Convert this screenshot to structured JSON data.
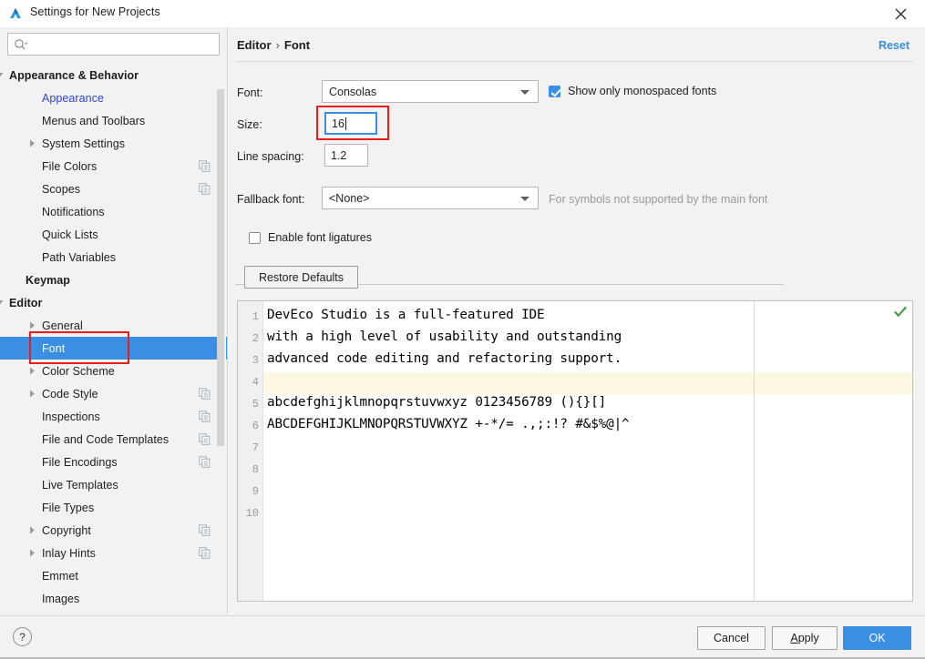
{
  "window": {
    "title": "Settings for New Projects",
    "icon": "deveco-studio-logo",
    "close_label": "×"
  },
  "search": {
    "value": "",
    "placeholder": "",
    "icon": "search-icon"
  },
  "sidebar": {
    "items": [
      {
        "label": "Appearance & Behavior",
        "indent": 10,
        "arrow": "down",
        "bold": true,
        "link": false,
        "selected": false,
        "copy": false
      },
      {
        "label": "Appearance",
        "indent": 46,
        "arrow": "none",
        "bold": false,
        "link": true,
        "selected": false,
        "copy": false
      },
      {
        "label": "Menus and Toolbars",
        "indent": 46,
        "arrow": "none",
        "bold": false,
        "link": false,
        "selected": false,
        "copy": false
      },
      {
        "label": "System Settings",
        "indent": 46,
        "arrow": "right",
        "bold": false,
        "link": false,
        "selected": false,
        "copy": false
      },
      {
        "label": "File Colors",
        "indent": 46,
        "arrow": "none",
        "bold": false,
        "link": false,
        "selected": false,
        "copy": true
      },
      {
        "label": "Scopes",
        "indent": 46,
        "arrow": "none",
        "bold": false,
        "link": false,
        "selected": false,
        "copy": true
      },
      {
        "label": "Notifications",
        "indent": 46,
        "arrow": "none",
        "bold": false,
        "link": false,
        "selected": false,
        "copy": false
      },
      {
        "label": "Quick Lists",
        "indent": 46,
        "arrow": "none",
        "bold": false,
        "link": false,
        "selected": false,
        "copy": false
      },
      {
        "label": "Path Variables",
        "indent": 46,
        "arrow": "none",
        "bold": false,
        "link": false,
        "selected": false,
        "copy": false
      },
      {
        "label": "Keymap",
        "indent": 28,
        "arrow": "none",
        "bold": true,
        "link": false,
        "selected": false,
        "copy": false
      },
      {
        "label": "Editor",
        "indent": 10,
        "arrow": "down",
        "bold": true,
        "link": false,
        "selected": false,
        "copy": false
      },
      {
        "label": "General",
        "indent": 46,
        "arrow": "right",
        "bold": false,
        "link": false,
        "selected": false,
        "copy": false
      },
      {
        "label": "Font",
        "indent": 46,
        "arrow": "none",
        "bold": false,
        "link": false,
        "selected": true,
        "copy": false
      },
      {
        "label": "Color Scheme",
        "indent": 46,
        "arrow": "right",
        "bold": false,
        "link": false,
        "selected": false,
        "copy": false
      },
      {
        "label": "Code Style",
        "indent": 46,
        "arrow": "right",
        "bold": false,
        "link": false,
        "selected": false,
        "copy": true
      },
      {
        "label": "Inspections",
        "indent": 46,
        "arrow": "none",
        "bold": false,
        "link": false,
        "selected": false,
        "copy": true
      },
      {
        "label": "File and Code Templates",
        "indent": 46,
        "arrow": "none",
        "bold": false,
        "link": false,
        "selected": false,
        "copy": true
      },
      {
        "label": "File Encodings",
        "indent": 46,
        "arrow": "none",
        "bold": false,
        "link": false,
        "selected": false,
        "copy": true
      },
      {
        "label": "Live Templates",
        "indent": 46,
        "arrow": "none",
        "bold": false,
        "link": false,
        "selected": false,
        "copy": false
      },
      {
        "label": "File Types",
        "indent": 46,
        "arrow": "none",
        "bold": false,
        "link": false,
        "selected": false,
        "copy": false
      },
      {
        "label": "Copyright",
        "indent": 46,
        "arrow": "right",
        "bold": false,
        "link": false,
        "selected": false,
        "copy": true
      },
      {
        "label": "Inlay Hints",
        "indent": 46,
        "arrow": "right",
        "bold": false,
        "link": false,
        "selected": false,
        "copy": true
      },
      {
        "label": "Emmet",
        "indent": 46,
        "arrow": "none",
        "bold": false,
        "link": false,
        "selected": false,
        "copy": false
      },
      {
        "label": "Images",
        "indent": 46,
        "arrow": "none",
        "bold": false,
        "link": false,
        "selected": false,
        "copy": false
      }
    ]
  },
  "breadcrumb": {
    "parent": "Editor",
    "separator": "›",
    "current": "Font"
  },
  "actions": {
    "reset": "Reset",
    "restore_defaults": "Restore Defaults"
  },
  "form": {
    "font_label": "Font:",
    "font_value": "Consolas",
    "size_label": "Size:",
    "size_value": "16",
    "line_spacing_label": "Line spacing:",
    "line_spacing_value": "1.2",
    "fallback_label": "Fallback font:",
    "fallback_value": "<None>",
    "fallback_hint": "For symbols not supported by the main font",
    "monospaced_label": "Show only monospaced fonts",
    "monospaced_checked": true,
    "ligatures_label": "Enable font ligatures",
    "ligatures_checked": false
  },
  "preview": {
    "line_numbers": [
      "1",
      "2",
      "3",
      "4",
      "5",
      "6",
      "7",
      "8",
      "9",
      "10"
    ],
    "highlighted_line": 4,
    "lines": [
      "DevEco Studio is a full-featured IDE",
      "with a high level of usability and outstanding",
      "advanced code editing and refactoring support.",
      "",
      "abcdefghijklmnopqrstuvwxyz 0123456789 (){}[]",
      "ABCDEFGHIJKLMNOPQRSTUVWXYZ +-*/= .,;:!? #&$%@|^"
    ],
    "status_icon": "green-check-icon"
  },
  "footer": {
    "help": "?",
    "cancel": "Cancel",
    "apply_prefix": "A",
    "apply_rest": "pply",
    "ok": "OK"
  },
  "colors": {
    "accent": "#3a8fe4",
    "link": "#2f42d8",
    "annotation": "#ee1b1b",
    "panel": "#f2f2f2",
    "highlight_row": "#fdf8e3"
  }
}
